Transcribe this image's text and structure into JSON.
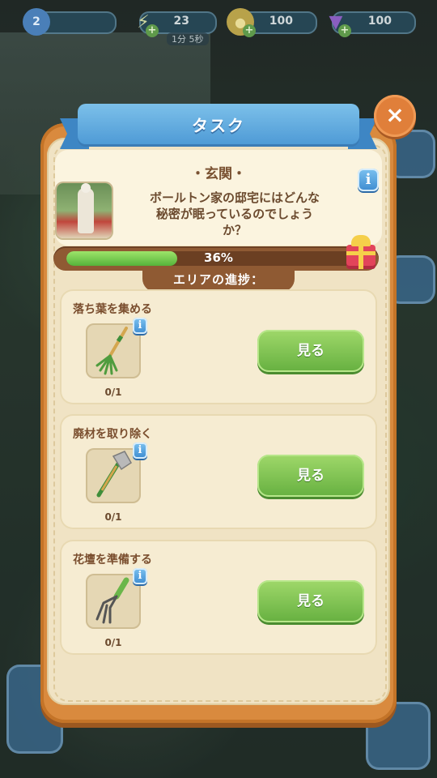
{
  "topbar": {
    "level": "2",
    "energy": {
      "value": "23",
      "timer": "1分 5秒"
    },
    "coins": {
      "value": "100"
    },
    "gems": {
      "value": "100"
    },
    "plus_label": "+"
  },
  "panel": {
    "title": "タスク",
    "close_label": "×",
    "area": {
      "name": "・玄関・",
      "description_lines": [
        "ボールトン家の邸宅にはどんな",
        "秘密が眠っているのでしょう",
        "か？"
      ],
      "progress_percent": 36,
      "progress_label": "36%"
    },
    "progress_heading": "エリアの進捗：",
    "info_label": "i",
    "tasks": [
      {
        "title": "落ち葉を集める",
        "tool_icon": "rake-icon",
        "count": "0/1",
        "button": "見る"
      },
      {
        "title": "廃材を取り除く",
        "tool_icon": "axe-icon",
        "count": "0/1",
        "button": "見る"
      },
      {
        "title": "花壇を準備する",
        "tool_icon": "garden-fork-icon",
        "count": "0/1",
        "button": "見る"
      }
    ]
  },
  "colors": {
    "panel_orange": "#d98a3e",
    "ribbon_blue": "#4f9bd6",
    "button_green": "#66b040",
    "progress_green": "#56b33a"
  }
}
